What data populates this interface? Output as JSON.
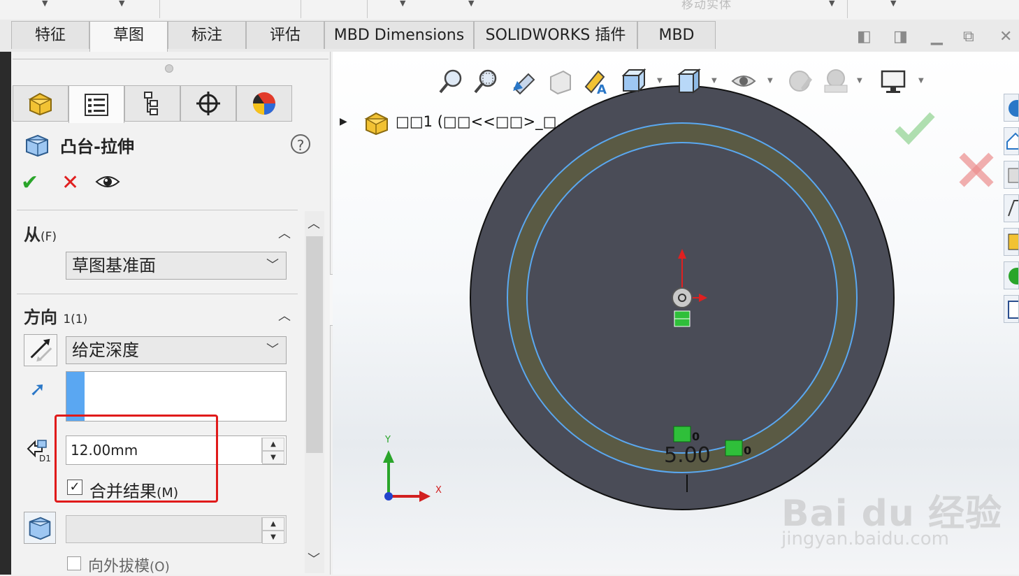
{
  "top_toolbar": {
    "faded_label": "移动实体"
  },
  "tabs": [
    {
      "label": "特征",
      "active": false
    },
    {
      "label": "草图",
      "active": true
    },
    {
      "label": "标注",
      "active": false
    },
    {
      "label": "评估",
      "active": false
    },
    {
      "label": "MBD Dimensions",
      "active": false
    },
    {
      "label": "SOLIDWORKS 插件",
      "active": false
    },
    {
      "label": "MBD",
      "active": false
    }
  ],
  "property_manager": {
    "title": "凸台-拉伸",
    "help": "?",
    "from_section": {
      "label": "从",
      "hotkey": "(F)",
      "value": "草图基准面"
    },
    "direction_section": {
      "label": "方向",
      "hotkey": "1(1)",
      "end_condition": "给定深度"
    },
    "depth": {
      "value": "12.00mm"
    },
    "merge_result": {
      "label": "合并结果",
      "hotkey": "(M)",
      "checked": true
    },
    "outward_draft": {
      "label": "向外拔模",
      "hotkey": "(O)",
      "checked": false
    }
  },
  "viewport": {
    "tree_label": "零件1 (默认<<默认>_显示状态 1>)",
    "tree_label_rendered": "□□1 (□□<<□□>_□.",
    "dimension_label": "5.00",
    "axis_labels": {
      "x": "X",
      "y": "Y"
    },
    "ring_color": "#5a5a44",
    "disk_color": "#4a4c57",
    "edge_color": "#5aa8f0"
  },
  "watermark": {
    "brand": "Bai du 经验",
    "url": "jingyan.baidu.com"
  },
  "colors": {
    "accent_red": "#e01a1a",
    "ok_green": "#2aa52a",
    "selection_blue": "#5aa7f2"
  }
}
